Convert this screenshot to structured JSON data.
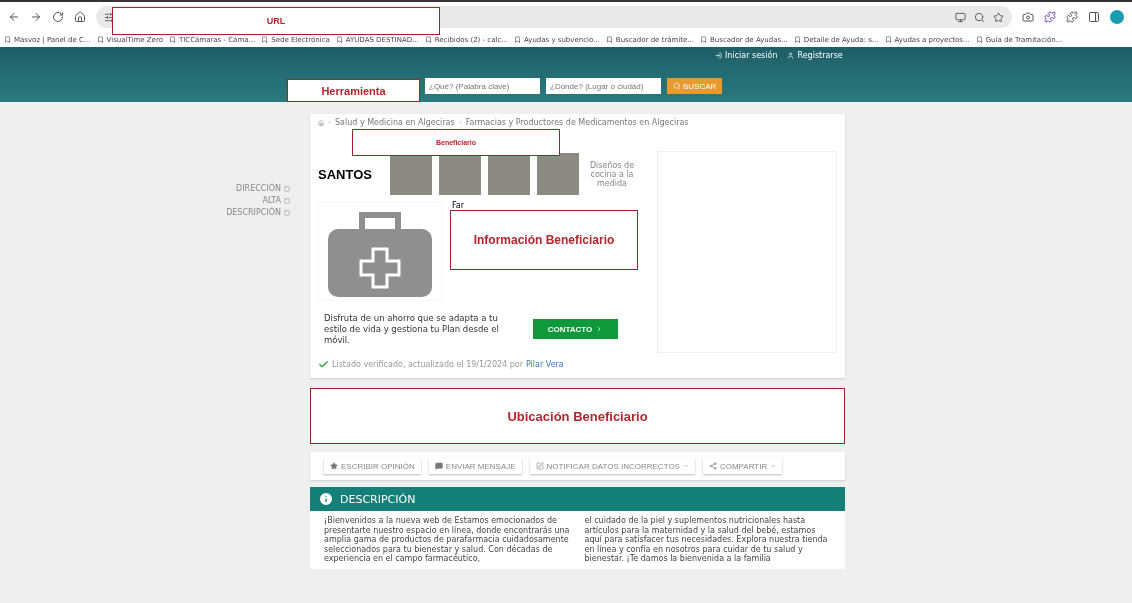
{
  "browser": {
    "annotation": "URL"
  },
  "bookmarks": [
    "Masvoz | Panel de C...",
    "VisualTime Zero",
    "TICCámaras - Cáma...",
    "Sede Electrónica",
    "AYUDAS DESTINAD...",
    "Recibidos (2) - calc...",
    "Ayudas y subvencio...",
    "Buscador de trámite...",
    "Buscador de Ayudas...",
    "Detalle de Ayuda: s...",
    "Ayudas a proyectos...",
    "Guía de Tramitación..."
  ],
  "header": {
    "annotation": "Herramienta",
    "what_placeholder": "¿Qué? (Palabra clave)",
    "where_placeholder": "¿Dónde? (Lugar o ciudad)",
    "search_button": "BUSCAR",
    "login": "Iniciar sesión",
    "register": "Registrarse"
  },
  "side_nav": [
    "DIRECCIÓN",
    "ALTA",
    "DESCRIPCIÓN"
  ],
  "breadcrumb": [
    "Salud y Medicina en Algeciras",
    "Farmacias y Productores de Medicamentos en Algeciras"
  ],
  "beneficiary_annotation": "Beneficiario",
  "banner_ad": {
    "brand": "SANTOS",
    "tagline": "Diseños de cocina a la medida"
  },
  "listing": {
    "name": "Far",
    "annotation": "Información Beneficiario"
  },
  "promo": {
    "text": "Disfruta de un ahorro que se adapta a tu estilo de vida y gestiona tu Plan desde el móvil.",
    "button": "CONTACTO"
  },
  "verified": {
    "text": "Listado verificado, actualizado el 19/1/2024 por",
    "author": "Pilar Vera"
  },
  "location_annotation": "Ubicación Beneficiario",
  "actions": [
    {
      "label": "ESCRIBIR OPINIÓN",
      "kind": "star",
      "dropdown": false
    },
    {
      "label": "ENVIAR MENSAJE",
      "kind": "message",
      "dropdown": false
    },
    {
      "label": "NOTIFICAR DATOS INCORRECTOS",
      "kind": "edit",
      "dropdown": true
    },
    {
      "label": "COMPARTIR",
      "kind": "share",
      "dropdown": true
    }
  ],
  "description": {
    "title": "DESCRIPCIÓN",
    "columns": [
      "¡Bienvenidos a la nueva web de Estamos emocionados de presentarte nuestro espacio en línea, donde encontrarás una amplia gama de productos de parafarmacia cuidadosamente seleccionados para tu bienestar y salud. Con décadas de experiencia en el campo farmacéutico,",
      "el cuidado de la piel y suplementos nutricionales hasta artículos para la maternidad y la salud del bebé, estamos aquí para satisfacer tus necesidades. Explora nuestra tienda en línea y confía en nosotros para cuidar de tu salud y bienestar. ¡Te damos la bienvenida a la familia"
    ]
  }
}
